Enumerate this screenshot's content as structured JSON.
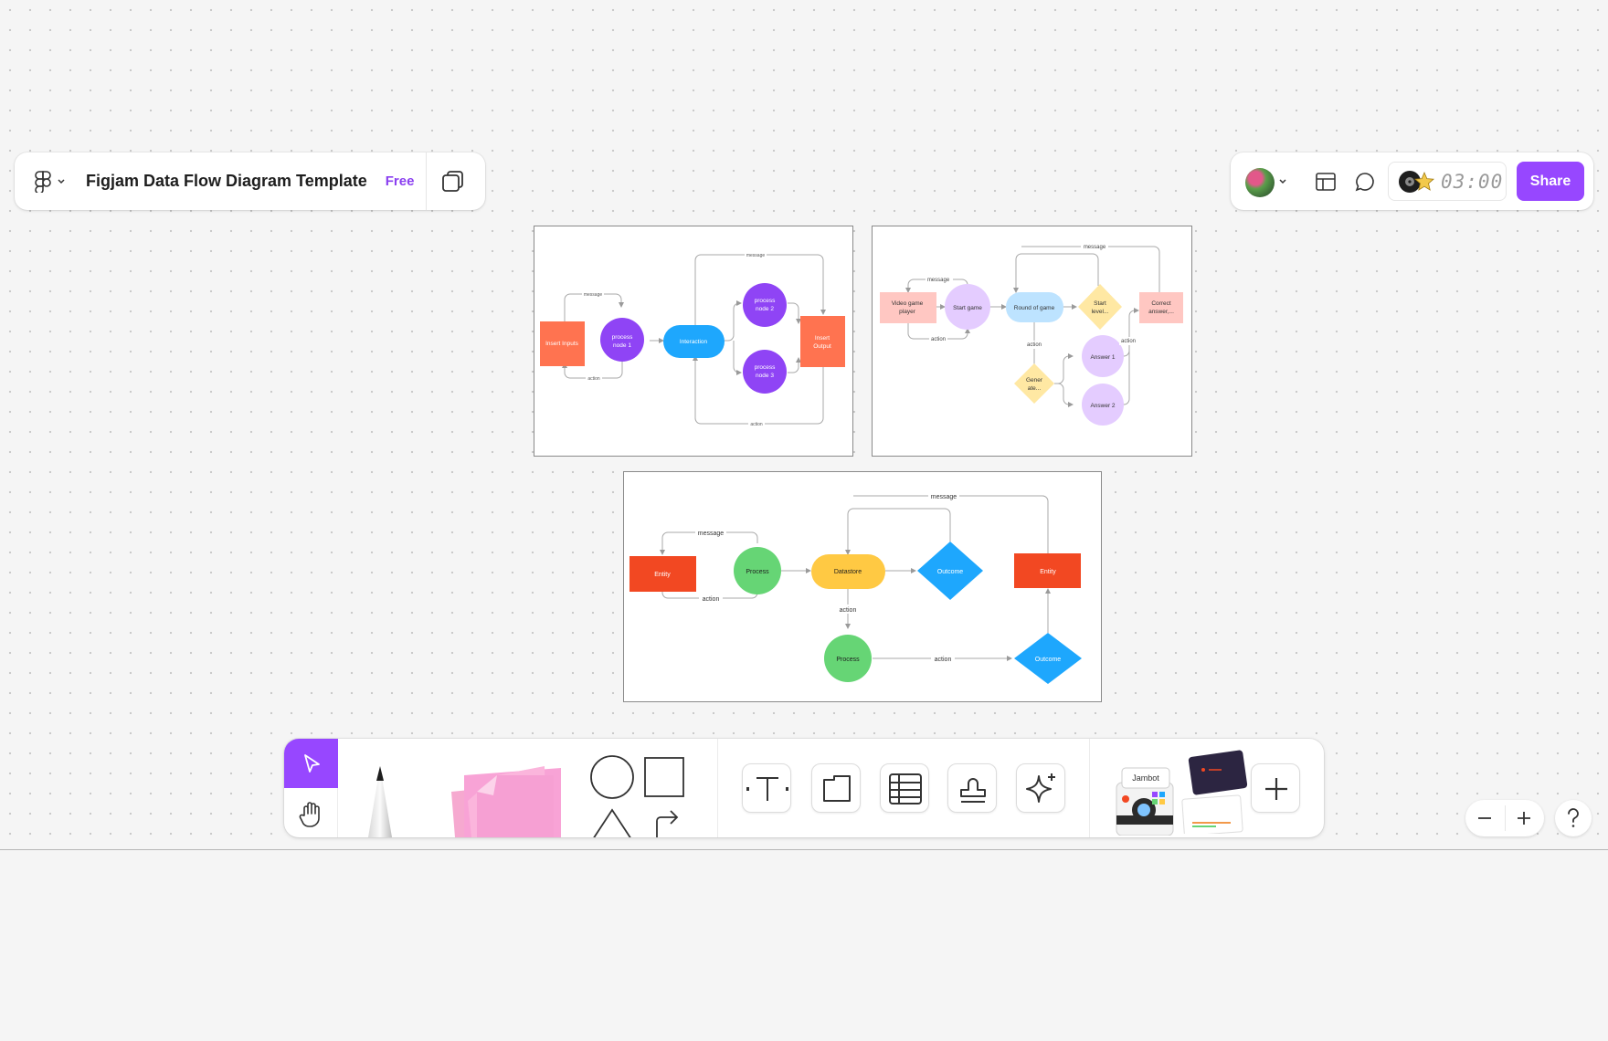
{
  "file": {
    "title": "Figjam Data Flow Diagram Template",
    "plan_badge": "Free"
  },
  "header": {
    "share_label": "Share",
    "timer": "03:00",
    "accent_color": "#9747ff"
  },
  "diagram1": {
    "labels": {
      "inputs": "Insert Inputs",
      "p1a": "process",
      "p1b": "node 1",
      "interaction": "Interaction",
      "p2a": "process",
      "p2b": "node 2",
      "p3a": "process",
      "p3b": "node 3",
      "out_a": "Insert",
      "out_b": "Output",
      "message_left": "message",
      "action_left": "action",
      "message_top": "message",
      "action_bottom": "action"
    }
  },
  "diagram2": {
    "labels": {
      "player_a": "Video game",
      "player_b": "player",
      "start_game": "Start game",
      "round": "Round of game",
      "start_level_a": "Start",
      "start_level_b": "level...",
      "correct_a": "Correct",
      "correct_b": "answer,...",
      "generate_a": "Gener",
      "generate_b": "ate...",
      "answer1": "Answer 1",
      "answer2": "Answer 2",
      "message_left": "message",
      "action_left": "action",
      "message_top": "message",
      "action_mid": "action",
      "action_right": "action"
    }
  },
  "diagram3": {
    "labels": {
      "entity_left": "Entity",
      "process_top": "Process",
      "datastore": "Datastore",
      "outcome_top": "Outcome",
      "entity_right": "Entity",
      "process_bottom": "Process",
      "outcome_bottom": "Outcome",
      "message_left": "message",
      "action_left": "action",
      "message_top": "message",
      "action_mid": "action",
      "action_bottom": "action"
    }
  },
  "toolbar": {
    "jambot_label": "Jambot"
  }
}
